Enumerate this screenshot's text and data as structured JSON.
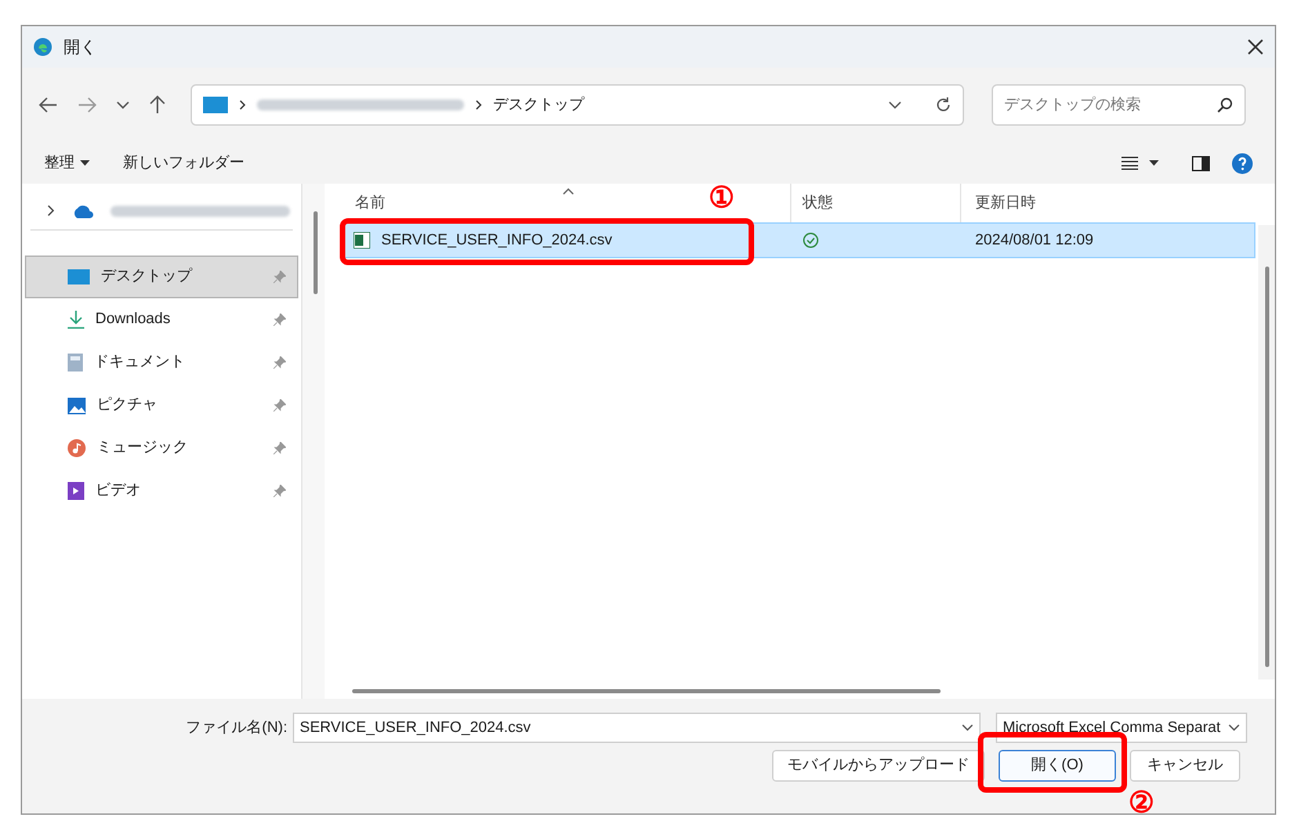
{
  "window": {
    "title": "開く"
  },
  "address": {
    "path": "デスクトップ"
  },
  "search": {
    "placeholder": "デスクトップの検索"
  },
  "toolbar": {
    "organize": "整理",
    "new_folder": "新しいフォルダー"
  },
  "sidebar": {
    "items": [
      {
        "kind": "cloud",
        "selected": false
      },
      {
        "kind": "desktop",
        "label": "デスクトップ",
        "selected": true
      },
      {
        "kind": "download",
        "label": "Downloads",
        "selected": false
      },
      {
        "kind": "document",
        "label": "ドキュメント",
        "selected": false
      },
      {
        "kind": "picture",
        "label": "ピクチャ",
        "selected": false
      },
      {
        "kind": "music",
        "label": "ミュージック",
        "selected": false
      },
      {
        "kind": "video",
        "label": "ビデオ",
        "selected": false
      }
    ]
  },
  "file_list": {
    "columns": [
      "名前",
      "状態",
      "更新日時"
    ],
    "rows": [
      {
        "name": "SERVICE_USER_INFO_2024.csv",
        "date": "2024/08/01 12:09",
        "selected": true
      }
    ]
  },
  "filename": {
    "label": "ファイル名(N):",
    "value": "SERVICE_USER_INFO_2024.csv"
  },
  "file_type": "Microsoft Excel Comma Separat",
  "buttons": [
    {
      "label": "モバイルからアップロード",
      "kind": "normal"
    },
    {
      "label": "開く(O)",
      "kind": "primary"
    },
    {
      "label": "キャンセル",
      "kind": "normal"
    }
  ],
  "annotations": [
    {
      "label": "①"
    },
    {
      "label": "②"
    }
  ]
}
